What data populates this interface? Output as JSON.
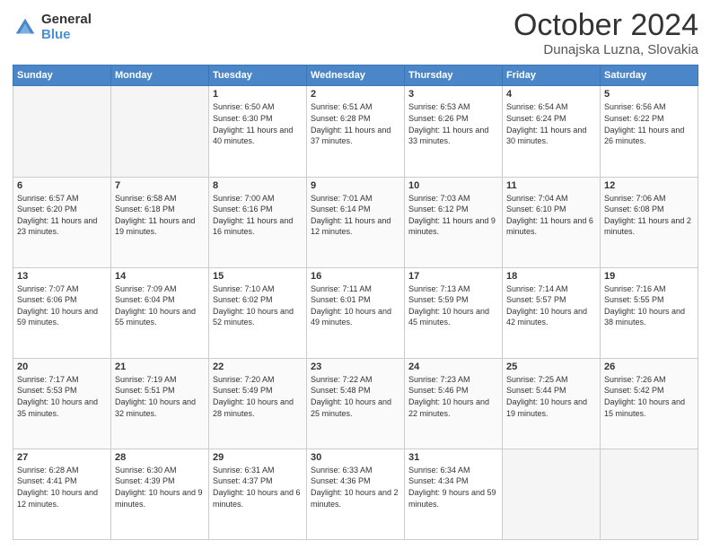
{
  "logo": {
    "general": "General",
    "blue": "Blue"
  },
  "header": {
    "month": "October 2024",
    "location": "Dunajska Luzna, Slovakia"
  },
  "days_of_week": [
    "Sunday",
    "Monday",
    "Tuesday",
    "Wednesday",
    "Thursday",
    "Friday",
    "Saturday"
  ],
  "weeks": [
    [
      {
        "day": "",
        "sunrise": "",
        "sunset": "",
        "daylight": ""
      },
      {
        "day": "",
        "sunrise": "",
        "sunset": "",
        "daylight": ""
      },
      {
        "day": "1",
        "sunrise": "Sunrise: 6:50 AM",
        "sunset": "Sunset: 6:30 PM",
        "daylight": "Daylight: 11 hours and 40 minutes."
      },
      {
        "day": "2",
        "sunrise": "Sunrise: 6:51 AM",
        "sunset": "Sunset: 6:28 PM",
        "daylight": "Daylight: 11 hours and 37 minutes."
      },
      {
        "day": "3",
        "sunrise": "Sunrise: 6:53 AM",
        "sunset": "Sunset: 6:26 PM",
        "daylight": "Daylight: 11 hours and 33 minutes."
      },
      {
        "day": "4",
        "sunrise": "Sunrise: 6:54 AM",
        "sunset": "Sunset: 6:24 PM",
        "daylight": "Daylight: 11 hours and 30 minutes."
      },
      {
        "day": "5",
        "sunrise": "Sunrise: 6:56 AM",
        "sunset": "Sunset: 6:22 PM",
        "daylight": "Daylight: 11 hours and 26 minutes."
      }
    ],
    [
      {
        "day": "6",
        "sunrise": "Sunrise: 6:57 AM",
        "sunset": "Sunset: 6:20 PM",
        "daylight": "Daylight: 11 hours and 23 minutes."
      },
      {
        "day": "7",
        "sunrise": "Sunrise: 6:58 AM",
        "sunset": "Sunset: 6:18 PM",
        "daylight": "Daylight: 11 hours and 19 minutes."
      },
      {
        "day": "8",
        "sunrise": "Sunrise: 7:00 AM",
        "sunset": "Sunset: 6:16 PM",
        "daylight": "Daylight: 11 hours and 16 minutes."
      },
      {
        "day": "9",
        "sunrise": "Sunrise: 7:01 AM",
        "sunset": "Sunset: 6:14 PM",
        "daylight": "Daylight: 11 hours and 12 minutes."
      },
      {
        "day": "10",
        "sunrise": "Sunrise: 7:03 AM",
        "sunset": "Sunset: 6:12 PM",
        "daylight": "Daylight: 11 hours and 9 minutes."
      },
      {
        "day": "11",
        "sunrise": "Sunrise: 7:04 AM",
        "sunset": "Sunset: 6:10 PM",
        "daylight": "Daylight: 11 hours and 6 minutes."
      },
      {
        "day": "12",
        "sunrise": "Sunrise: 7:06 AM",
        "sunset": "Sunset: 6:08 PM",
        "daylight": "Daylight: 11 hours and 2 minutes."
      }
    ],
    [
      {
        "day": "13",
        "sunrise": "Sunrise: 7:07 AM",
        "sunset": "Sunset: 6:06 PM",
        "daylight": "Daylight: 10 hours and 59 minutes."
      },
      {
        "day": "14",
        "sunrise": "Sunrise: 7:09 AM",
        "sunset": "Sunset: 6:04 PM",
        "daylight": "Daylight: 10 hours and 55 minutes."
      },
      {
        "day": "15",
        "sunrise": "Sunrise: 7:10 AM",
        "sunset": "Sunset: 6:02 PM",
        "daylight": "Daylight: 10 hours and 52 minutes."
      },
      {
        "day": "16",
        "sunrise": "Sunrise: 7:11 AM",
        "sunset": "Sunset: 6:01 PM",
        "daylight": "Daylight: 10 hours and 49 minutes."
      },
      {
        "day": "17",
        "sunrise": "Sunrise: 7:13 AM",
        "sunset": "Sunset: 5:59 PM",
        "daylight": "Daylight: 10 hours and 45 minutes."
      },
      {
        "day": "18",
        "sunrise": "Sunrise: 7:14 AM",
        "sunset": "Sunset: 5:57 PM",
        "daylight": "Daylight: 10 hours and 42 minutes."
      },
      {
        "day": "19",
        "sunrise": "Sunrise: 7:16 AM",
        "sunset": "Sunset: 5:55 PM",
        "daylight": "Daylight: 10 hours and 38 minutes."
      }
    ],
    [
      {
        "day": "20",
        "sunrise": "Sunrise: 7:17 AM",
        "sunset": "Sunset: 5:53 PM",
        "daylight": "Daylight: 10 hours and 35 minutes."
      },
      {
        "day": "21",
        "sunrise": "Sunrise: 7:19 AM",
        "sunset": "Sunset: 5:51 PM",
        "daylight": "Daylight: 10 hours and 32 minutes."
      },
      {
        "day": "22",
        "sunrise": "Sunrise: 7:20 AM",
        "sunset": "Sunset: 5:49 PM",
        "daylight": "Daylight: 10 hours and 28 minutes."
      },
      {
        "day": "23",
        "sunrise": "Sunrise: 7:22 AM",
        "sunset": "Sunset: 5:48 PM",
        "daylight": "Daylight: 10 hours and 25 minutes."
      },
      {
        "day": "24",
        "sunrise": "Sunrise: 7:23 AM",
        "sunset": "Sunset: 5:46 PM",
        "daylight": "Daylight: 10 hours and 22 minutes."
      },
      {
        "day": "25",
        "sunrise": "Sunrise: 7:25 AM",
        "sunset": "Sunset: 5:44 PM",
        "daylight": "Daylight: 10 hours and 19 minutes."
      },
      {
        "day": "26",
        "sunrise": "Sunrise: 7:26 AM",
        "sunset": "Sunset: 5:42 PM",
        "daylight": "Daylight: 10 hours and 15 minutes."
      }
    ],
    [
      {
        "day": "27",
        "sunrise": "Sunrise: 6:28 AM",
        "sunset": "Sunset: 4:41 PM",
        "daylight": "Daylight: 10 hours and 12 minutes."
      },
      {
        "day": "28",
        "sunrise": "Sunrise: 6:30 AM",
        "sunset": "Sunset: 4:39 PM",
        "daylight": "Daylight: 10 hours and 9 minutes."
      },
      {
        "day": "29",
        "sunrise": "Sunrise: 6:31 AM",
        "sunset": "Sunset: 4:37 PM",
        "daylight": "Daylight: 10 hours and 6 minutes."
      },
      {
        "day": "30",
        "sunrise": "Sunrise: 6:33 AM",
        "sunset": "Sunset: 4:36 PM",
        "daylight": "Daylight: 10 hours and 2 minutes."
      },
      {
        "day": "31",
        "sunrise": "Sunrise: 6:34 AM",
        "sunset": "Sunset: 4:34 PM",
        "daylight": "Daylight: 9 hours and 59 minutes."
      },
      {
        "day": "",
        "sunrise": "",
        "sunset": "",
        "daylight": ""
      },
      {
        "day": "",
        "sunrise": "",
        "sunset": "",
        "daylight": ""
      }
    ]
  ]
}
